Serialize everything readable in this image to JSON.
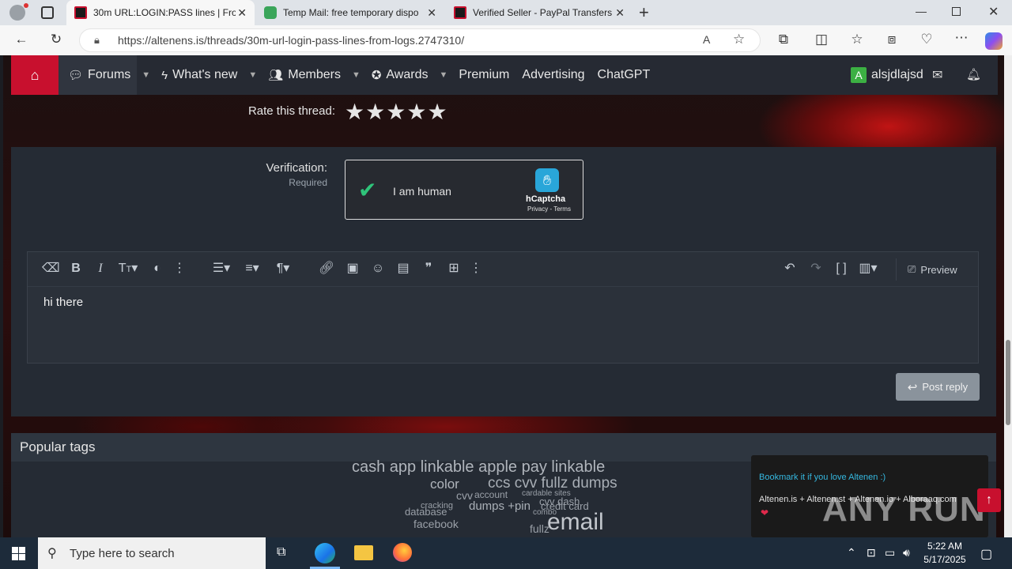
{
  "browser": {
    "tabs": [
      {
        "title": "30m URL:LOGIN:PASS lines | Fron",
        "icon": "altenen-favicon",
        "active": true
      },
      {
        "title": "Temp Mail: free temporary dispo",
        "icon": "shield-check-favicon",
        "active": false
      },
      {
        "title": "Verified Seller - PayPal Transfers",
        "icon": "altenen-favicon",
        "active": false
      }
    ],
    "url": "https://altenens.is/threads/30m-url-login-pass-lines-from-logs.2747310/"
  },
  "nav": {
    "items": [
      "Forums",
      "What's new",
      "Members",
      "Awards",
      "Premium",
      "Advertising",
      "ChatGPT"
    ],
    "user": "alsjdlajsd",
    "user_initial": "A"
  },
  "rating": {
    "label": "Rate this thread:",
    "stars": 5
  },
  "verification": {
    "label": "Verification:",
    "required": "Required",
    "captcha_text": "I am human",
    "brand": "hCaptcha",
    "links": "Privacy - Terms"
  },
  "editor": {
    "text": "hi there",
    "preview_label": "Preview"
  },
  "post_reply_label": "Post reply",
  "tags": {
    "header": "Popular tags",
    "items": [
      {
        "text": "cash app linkable apple pay linkable",
        "size": 20
      },
      {
        "text": "color",
        "size": 17
      },
      {
        "text": "ccs cvv fullz dumps",
        "size": 19
      },
      {
        "text": "cvv",
        "size": 14
      },
      {
        "text": "account",
        "size": 12
      },
      {
        "text": "cardable sites",
        "size": 10
      },
      {
        "text": "cracking",
        "size": 11
      },
      {
        "text": "dumps +pin",
        "size": 15
      },
      {
        "text": "cvv dash",
        "size": 13
      },
      {
        "text": "credit card",
        "size": 13
      },
      {
        "text": "database",
        "size": 13
      },
      {
        "text": "combo",
        "size": 10
      },
      {
        "text": "facebook",
        "size": 14
      },
      {
        "text": "email",
        "size": 30
      },
      {
        "text": "fullz",
        "size": 14
      }
    ]
  },
  "bookmark": {
    "title": "Bookmark it if you love Altenen :)",
    "links": "Altenen.is + Altenen.st + Altenen.io + Alboraaq.com"
  },
  "watermark": "ANY RUN",
  "taskbar": {
    "search_placeholder": "Type here to search",
    "time": "5:22 AM",
    "date": "5/17/2025"
  }
}
